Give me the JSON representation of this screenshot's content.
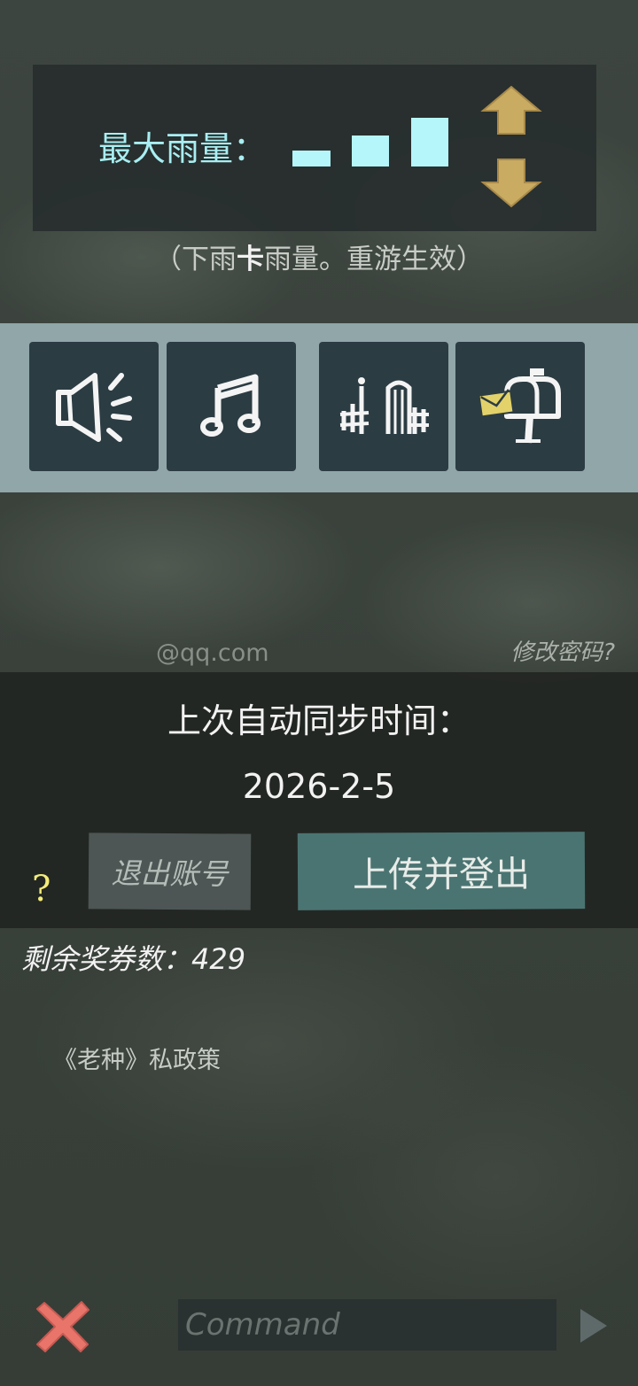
{
  "rain": {
    "label": "最大雨量：",
    "level_count": 3,
    "hint_open": "（下雨",
    "hint_bold": "卡",
    "hint_close": "雨量。重游生效）"
  },
  "toolbar": {
    "icons": [
      "speaker-icon",
      "music-note-icon",
      "fence-gate-icon",
      "mailbox-icon"
    ]
  },
  "account": {
    "email_fragment": "@qq.com",
    "change_password": "修改密码?"
  },
  "sync": {
    "label": "上次自动同步时间：",
    "date": "2026-2-5",
    "help": "?",
    "logout_label": "退出账号",
    "upload_logout_label": "上传并登出"
  },
  "tickets": {
    "text": "剩余奖券数：429"
  },
  "policy": {
    "text": "《老种》私政策"
  },
  "command": {
    "placeholder": "Command"
  },
  "colors": {
    "accent_cyan": "#b5f6fb",
    "arrow_gold": "#c9ab62",
    "upload_teal": "#4a7472",
    "close_red": "#e8746a",
    "help_yellow": "#f4ec7a"
  }
}
